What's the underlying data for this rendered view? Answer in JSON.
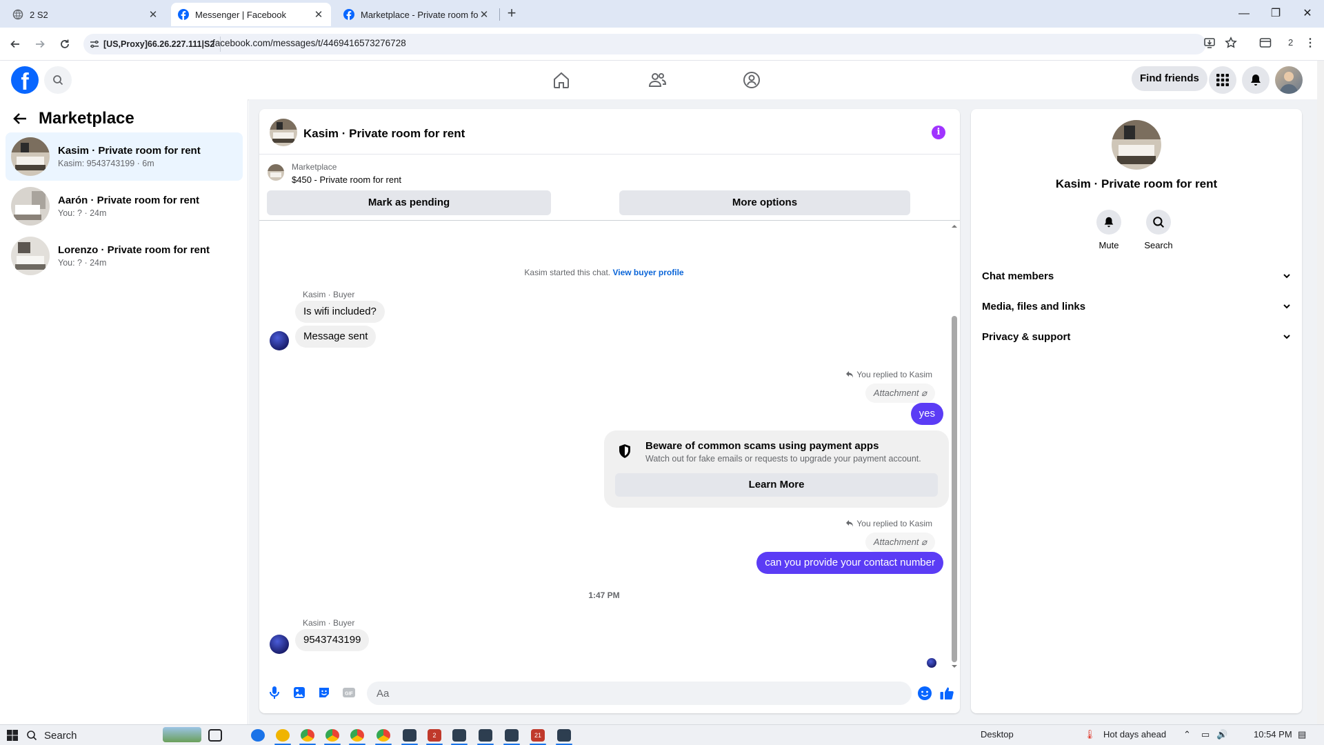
{
  "browser": {
    "tabs": [
      {
        "title": "2 S2",
        "active": false
      },
      {
        "title": "Messenger | Facebook",
        "active": true
      },
      {
        "title": "Marketplace - Private room for",
        "active": false
      }
    ],
    "new_tab": "+",
    "proxy_chip": "[US,Proxy]66.26.227.111|S2",
    "url": "facebook.com/messages/t/4469416573276728",
    "profile_count": "2",
    "win_min": "—",
    "win_restore": "❐",
    "win_close": "✕"
  },
  "header": {
    "logo": "f",
    "find_friends": "Find friends"
  },
  "sidebar": {
    "title": "Marketplace",
    "threads": [
      {
        "name": "Kasim · Private room for rent",
        "preview": "Kasim: 9543743199 · 6m",
        "selected": true
      },
      {
        "name": "Aarón · Private room for rent",
        "preview": "You: ? · 24m",
        "selected": false
      },
      {
        "name": "Lorenzo · Private room for rent",
        "preview": "You: ? · 24m",
        "selected": false
      }
    ]
  },
  "chat": {
    "title": "Kasim · Private room for rent",
    "info_icon": "i",
    "marketplace_label": "Marketplace",
    "listing": "$450 - Private room for rent",
    "mark_pending": "Mark as pending",
    "more_options": "More options",
    "started_text": "Kasim started this chat.",
    "view_profile": "View buyer profile",
    "sender1": "Kasim · Buyer",
    "msg1": "Is wifi included?",
    "msg2": "Message sent",
    "replied1": "You replied to Kasim",
    "attachment1": "Attachment",
    "out1": "yes",
    "scam_title": "Beware of common scams using payment apps",
    "scam_sub": "Watch out for fake emails or requests to upgrade your payment account.",
    "learn_more": "Learn More",
    "replied2": "You replied to Kasim",
    "attachment2": "Attachment",
    "out2": "can you provide your contact number",
    "time": "1:47 PM",
    "sender2": "Kasim · Buyer",
    "msg3": "9543743199",
    "input_placeholder": "Aa"
  },
  "info_panel": {
    "name": "Kasim · Private room for rent",
    "mute": "Mute",
    "search": "Search",
    "sections": [
      "Chat members",
      "Media, files and links",
      "Privacy & support"
    ]
  },
  "taskbar": {
    "search": "Search",
    "desktop": "Desktop",
    "weather": "Hot days ahead",
    "clock": "10:54 PM",
    "badge_a": "2",
    "badge_b": "21"
  },
  "colors": {
    "fb_blue": "#0866ff",
    "outgoing_bubble": "#5b3cf5",
    "selected_thread": "#ebf5ff",
    "info_icon": "#a033ff"
  }
}
